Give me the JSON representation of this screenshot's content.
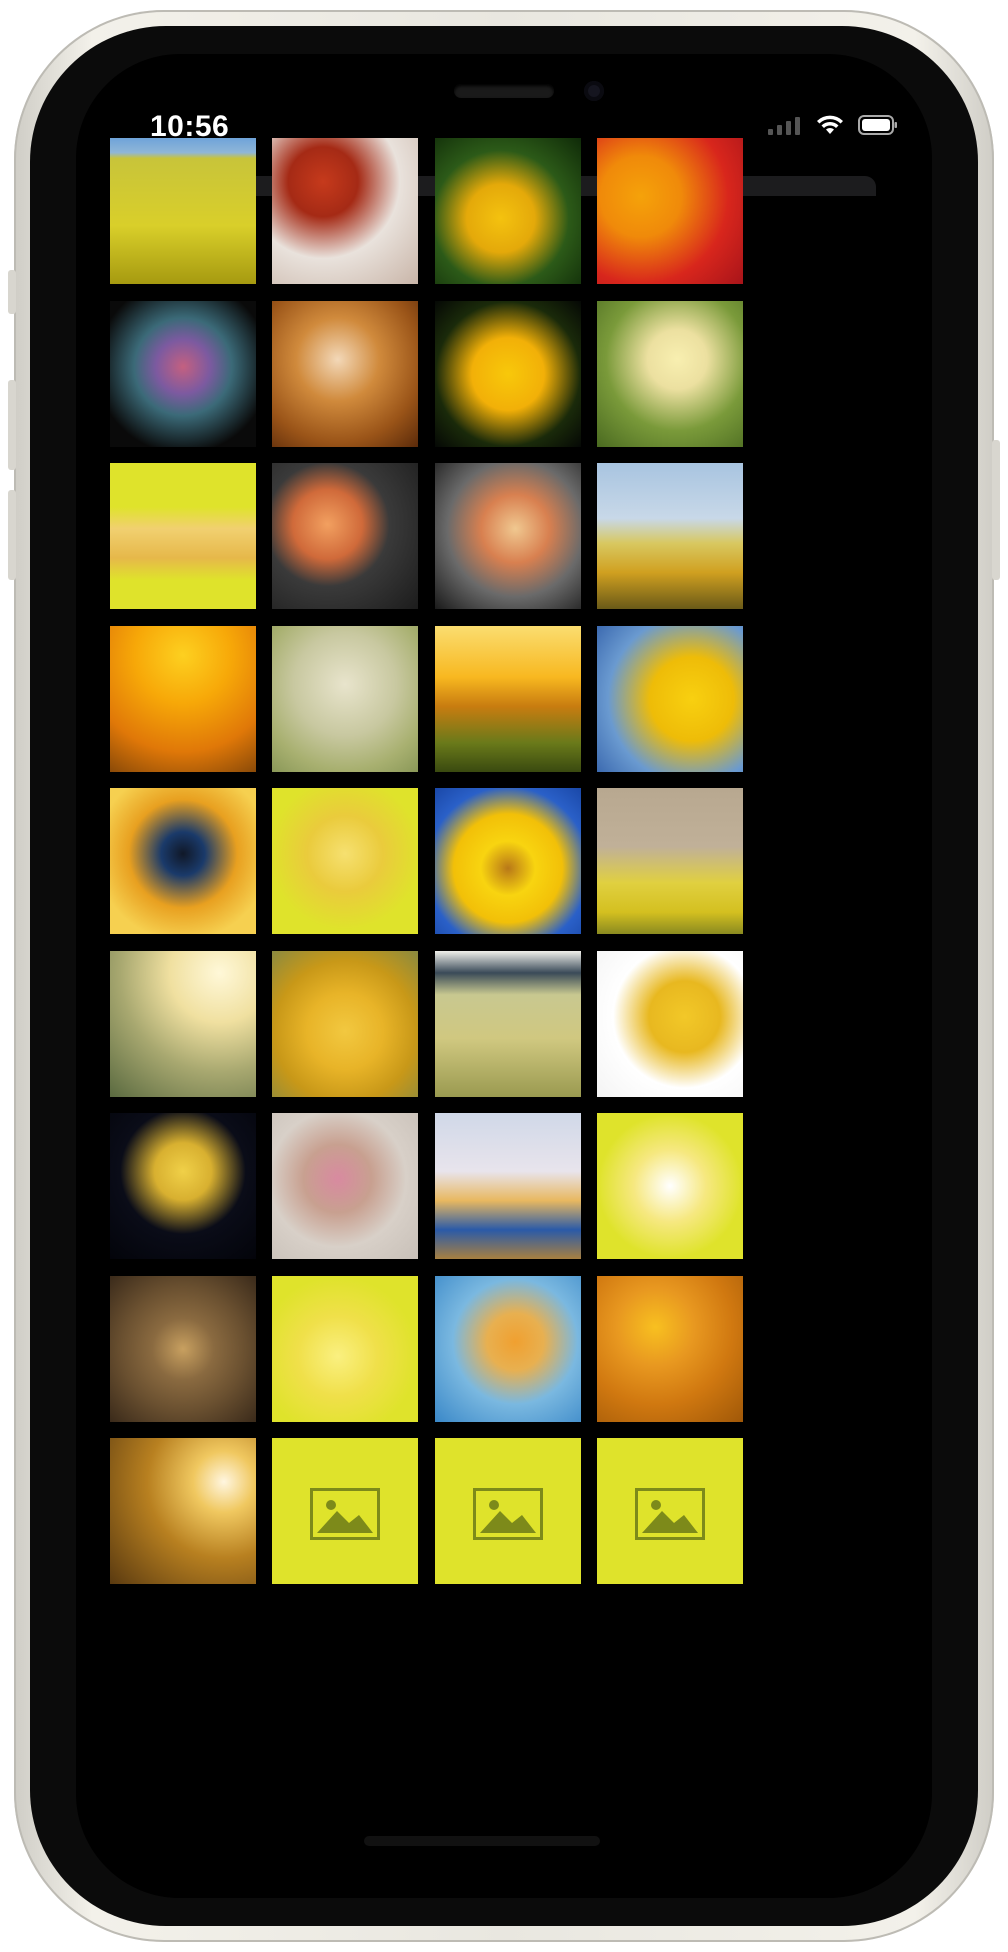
{
  "status_bar": {
    "time": "10:56",
    "signal_icon": "cellular-signal-icon",
    "wifi_icon": "wifi-icon",
    "battery_icon": "battery-icon"
  },
  "colors": {
    "placeholder_bg": "#dfe32b",
    "placeholder_icon": "#7d8a1a",
    "screen_bg": "#000000"
  },
  "tiles": [
    {
      "name": "rapeseed-field",
      "bg": "linear-gradient(180deg,#6fa3d9 0%,#8fb6d8 10%,#c8c43a 14%,#d9cf2a 60%,#a69a10 100%)"
    },
    {
      "name": "red-maple-leaves",
      "bg": "radial-gradient(circle at 35% 30%,#c63a1c 0%,#a52a15 25%,#e9e2dc 55%,#c9b5a8 100%)"
    },
    {
      "name": "sunflower-closeup",
      "bg": "radial-gradient(circle at 45% 55%,#f4c20f 0%,#e4a90a 30%,#2c5a18 60%,#0f2a08 100%)"
    },
    {
      "name": "bell-peppers",
      "bg": "radial-gradient(circle at 30% 40%,#f5a20a 0%,#f08a0a 30%,#d8261c 65%,#a8141a 100%)"
    },
    {
      "name": "colored-chalk",
      "bg": "radial-gradient(circle at 50% 45%,#c46080 0%,#7c5aa0 25%,#3b6a78 45%,#0a0a0a 80%)"
    },
    {
      "name": "citrine-crystal",
      "bg": "radial-gradient(circle at 45% 40%,#f3d8b8 0%,#d08a3c 35%,#9a5418 70%,#5a2a0a 100%)"
    },
    {
      "name": "yellow-gazania-flower",
      "bg": "radial-gradient(circle at 50% 50%,#f8c80a 0%,#f2b008 35%,#1a2a0a 70%,#050805 100%)"
    },
    {
      "name": "baby-chicks",
      "bg": "radial-gradient(circle at 55% 40%,#f8efb0 0%,#ece0a0 25%,#7a9a3a 60%,#4a6a20 100%)"
    },
    {
      "name": "banana-illustration",
      "bg": "linear-gradient(180deg,#dfe32b 0%,#dfe32b 30%,#f1d070 45%,#e6b84a 65%,#dfe32b 80%)"
    },
    {
      "name": "orange-rose",
      "bg": "radial-gradient(circle at 38% 42%,#f2a060 0%,#d06a3a 28%,#3a3a3a 50%,#1c1c1c 100%)"
    },
    {
      "name": "pasta-bowl",
      "bg": "radial-gradient(circle at 55% 45%,#f0c890 0%,#d88050 30%,#6a6a6a 60%,#1a1a1a 100%)"
    },
    {
      "name": "dandelion-field",
      "bg": "linear-gradient(180deg,#a8c4e0 0%,#c8d8e8 38%,#d8c860 55%,#d0a020 75%,#6a5a18 100%)"
    },
    {
      "name": "under-construction",
      "bg": "radial-gradient(circle at 50% 20%,#fdd020 0%,#f7a808 35%,#e07808 70%,#8a4a08 100%)"
    },
    {
      "name": "yellow-wagtail-bird",
      "bg": "radial-gradient(circle at 50% 40%,#e8e4cc 0%,#c8c8a0 45%,#a8b070 75%,#8a9858 100%)"
    },
    {
      "name": "sunset-grass",
      "bg": "linear-gradient(180deg,#fadd70 0%,#f8b820 35%,#c87c10 55%,#6a7a1a 80%,#3a4a10 100%)"
    },
    {
      "name": "sunflowers-blue-sky",
      "bg": "radial-gradient(circle at 65% 50%,#f8d010 0%,#eebc08 35%,#6a9ad0 70%,#3c6ab0 100%)"
    },
    {
      "name": "paint-splash",
      "bg": "radial-gradient(circle at 50% 45%,#101828 0%,#1a3a6a 20%,#e8a020 50%,#f6d050 80%)"
    },
    {
      "name": "banana-bunch-illustration",
      "bg": "radial-gradient(circle at 50% 45%,#f6e070 0%,#eacb3c 35%,#dfe32b 70%,#dfe32b 100%)"
    },
    {
      "name": "sunflower-blue-background",
      "bg": "radial-gradient(circle at 50% 55%,#b87818 0%,#f8d410 25%,#f2c008 50%,#2a60c8 75%,#1a48a8 100%)"
    },
    {
      "name": "bird-on-rapeseed",
      "bg": "linear-gradient(180deg,#b8a890 0%,#c0b098 40%,#e0d040 65%,#d4c020 85%,#8a8a20 100%)"
    },
    {
      "name": "wildflowers-sunlight",
      "bg": "radial-gradient(circle at 75% 15%,#fff8d8 0%,#f0e0a0 30%,#a8a870 60%,#5a6a40 100%)"
    },
    {
      "name": "corn-cobs",
      "bg": "radial-gradient(circle at 50% 55%,#f2c840 0%,#e8b428 35%,#c89818 65%,#8a8a40 100%)"
    },
    {
      "name": "wheat-field",
      "bg": "linear-gradient(180deg,#f0f0ea 0%,#3a4a58 15%,#c8c890 30%,#d0c880 60%,#9a9a50 100%)"
    },
    {
      "name": "bananas-white",
      "bg": "radial-gradient(circle at 60% 45%,#f2c828 0%,#e8b820 30%,#ffffff 60%,#f4f4f4 100%)"
    },
    {
      "name": "yellow-tulips",
      "bg": "radial-gradient(circle at 50% 40%,#f0d048 0%,#d8b030 25%,#0a0c18 55%,#03040a 100%)"
    },
    {
      "name": "flower-dress-woman",
      "bg": "radial-gradient(circle at 45% 45%,#d88aa0 0%,#c8a090 30%,#d8d0c8 60%,#c8c0b8 100%)"
    },
    {
      "name": "colorful-houses",
      "bg": "linear-gradient(180deg,#d0d8e8 0%,#e8e4ec 40%,#e8b860 60%,#2a5aa8 80%,#a88040 100%)"
    },
    {
      "name": "butterflyfish-illustration",
      "bg": "radial-gradient(circle at 50% 50%,#ffffff 0%,#f6e880 35%,#dfe32b 70%,#dfe32b 100%)"
    },
    {
      "name": "supermarket-aerial",
      "bg": "radial-gradient(circle at 50% 50%,#c8a060 0%,#8a6a40 30%,#6a5030 60%,#3a2a1a 100%)"
    },
    {
      "name": "kawaii-banana",
      "bg": "radial-gradient(circle at 45% 55%,#faf080 0%,#f0e04a 35%,#dfe32b 70%,#dfe32b 100%)"
    },
    {
      "name": "forsythia-branch",
      "bg": "radial-gradient(circle at 55% 45%,#f0a030 0%,#e8b050 25%,#7ab8e0 55%,#3a88c8 100%)"
    },
    {
      "name": "daffodils-vase",
      "bg": "radial-gradient(circle at 40% 35%,#f8c020 0%,#e89820 30%,#d07810 60%,#a05808 100%)"
    },
    {
      "name": "sunflower-sunset",
      "bg": "radial-gradient(circle at 78% 30%,#fff6e0 0%,#f0c860 20%,#b88020 50%,#5a3a10 100%)"
    },
    {
      "name": "image-placeholder",
      "bg": "#dfe32b",
      "placeholder": true
    },
    {
      "name": "image-placeholder",
      "bg": "#dfe32b",
      "placeholder": true
    },
    {
      "name": "image-placeholder",
      "bg": "#dfe32b",
      "placeholder": true
    }
  ]
}
